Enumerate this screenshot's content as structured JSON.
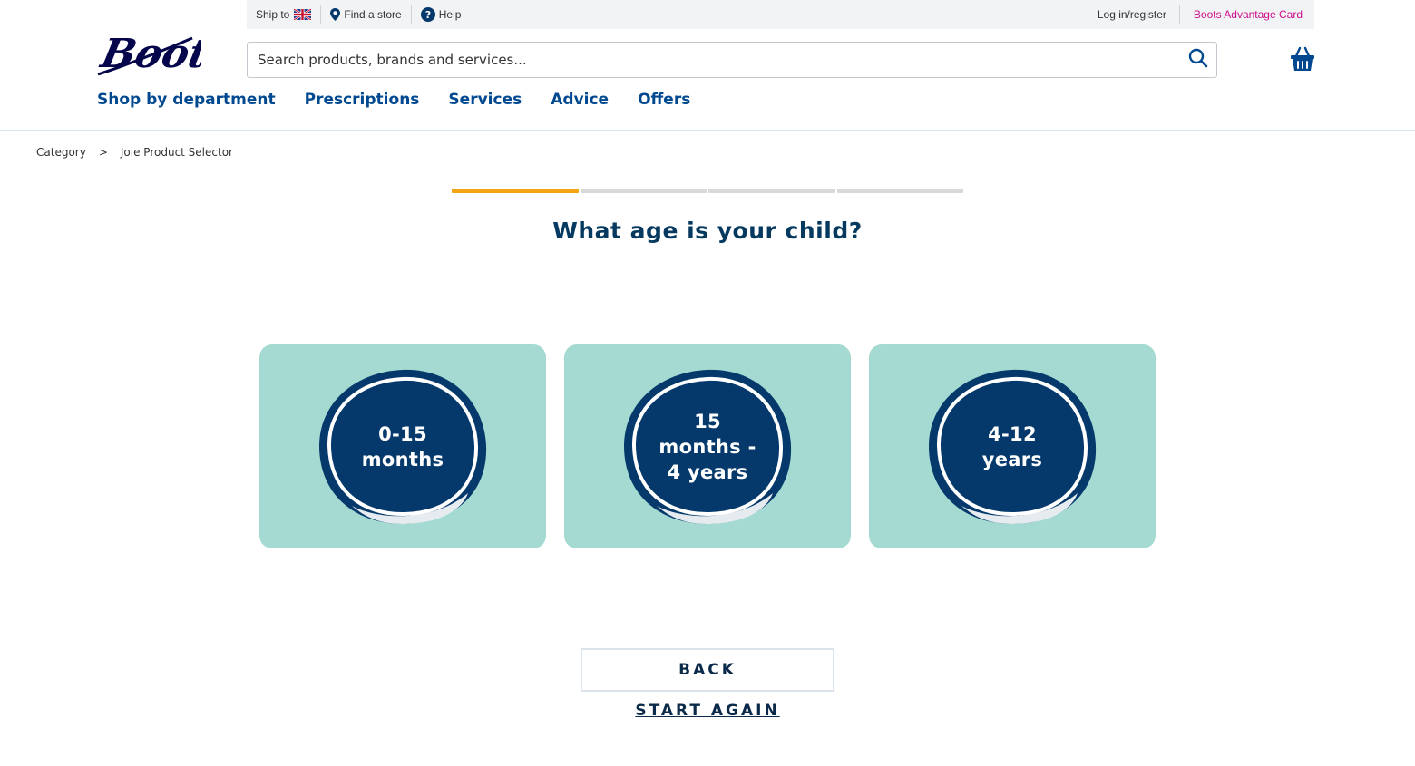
{
  "brand": {
    "logo_text": "Boots",
    "colors": {
      "navy": "#05054b",
      "nav_blue": "#004990",
      "pink": "#cc0a8b",
      "teal_card": "#a4dad1",
      "progress": "#f4a516",
      "blob_navy": "#05396b"
    }
  },
  "utility_bar": {
    "ship_to": "Ship to",
    "find_store": "Find a store",
    "help": "Help",
    "login": "Log in/register",
    "advantage_card": "Boots Advantage Card"
  },
  "search": {
    "placeholder": "Search products, brands and services..."
  },
  "nav": {
    "items": [
      "Shop by department",
      "Prescriptions",
      "Services",
      "Advice",
      "Offers"
    ]
  },
  "breadcrumb": {
    "items": [
      "Category",
      "Joie Product Selector"
    ],
    "separator": ">"
  },
  "progress": {
    "steps_total": 4,
    "steps_completed": 1
  },
  "question": "What age is your child?",
  "options": [
    {
      "label": "0-15 months"
    },
    {
      "label": "15 months - 4 years"
    },
    {
      "label": "4-12 years"
    }
  ],
  "buttons": {
    "back": "BACK",
    "start_again": "START AGAIN"
  }
}
